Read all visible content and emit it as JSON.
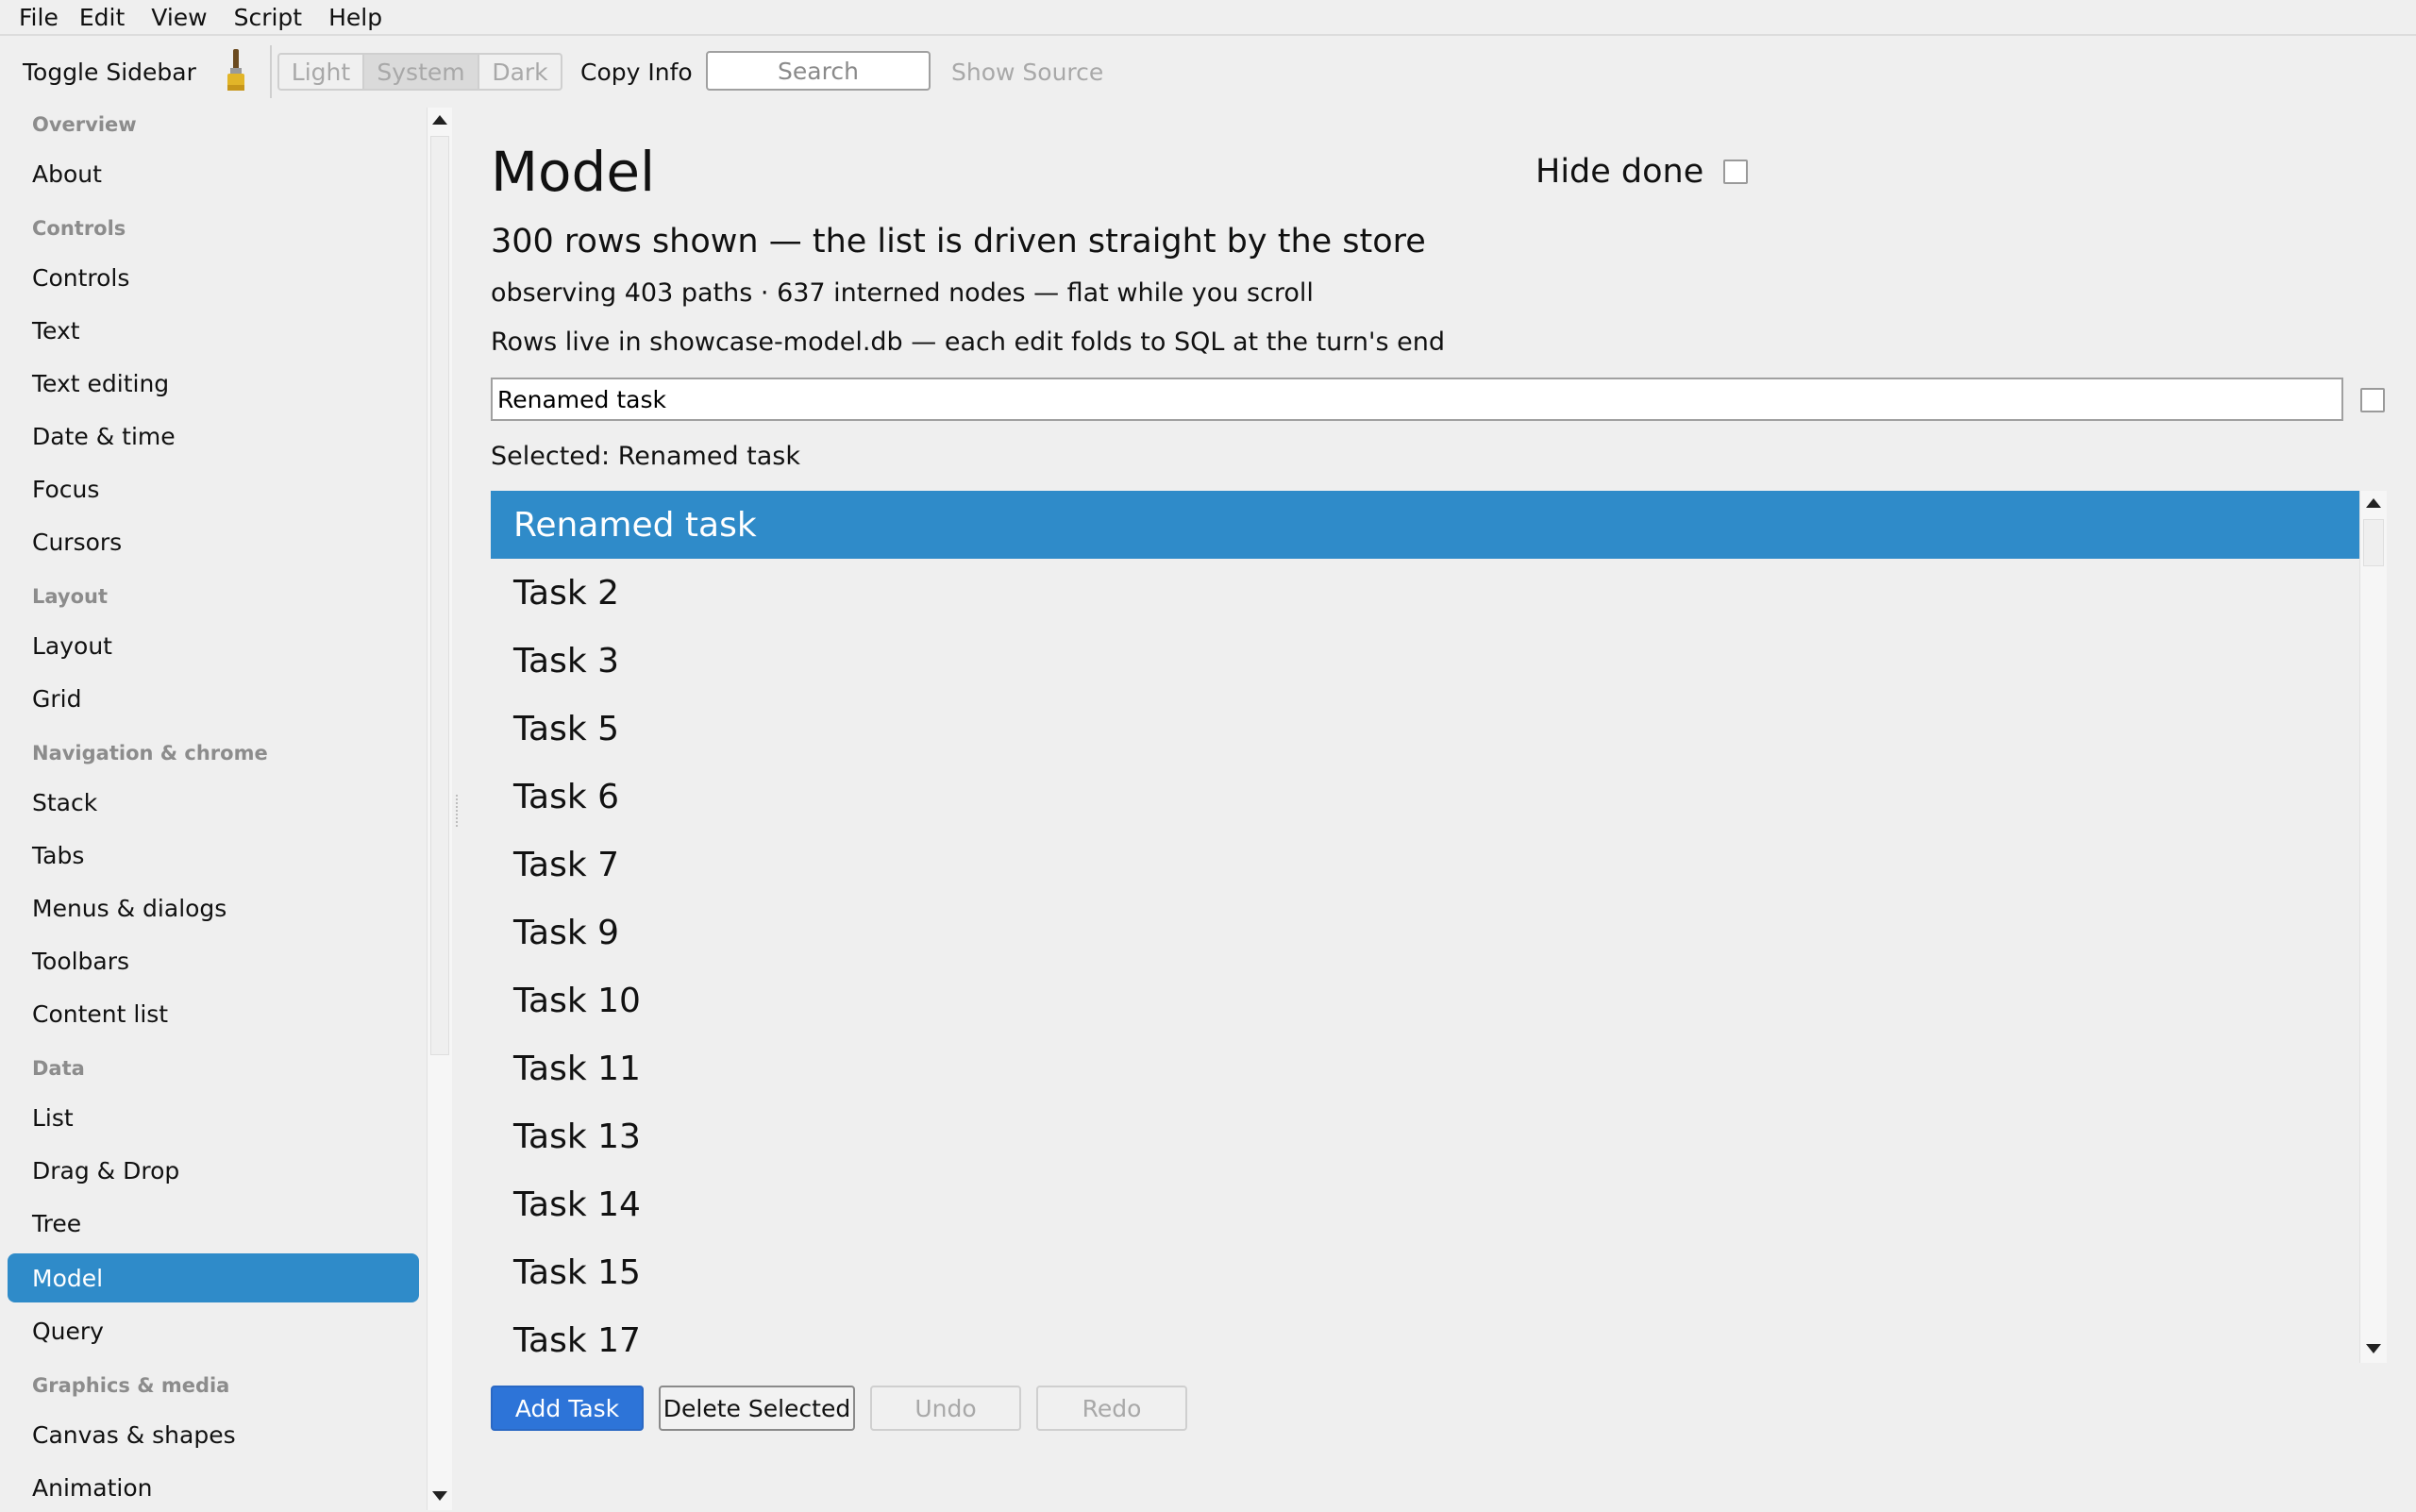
{
  "menubar": [
    "File",
    "Edit",
    "View",
    "Script",
    "Help"
  ],
  "toolbar": {
    "toggle_sidebar": "Toggle Sidebar",
    "theme": {
      "light": "Light",
      "system": "System",
      "dark": "Dark",
      "selected": "System"
    },
    "copy_info": "Copy Info",
    "search_placeholder": "Search",
    "show_source": "Show Source"
  },
  "sidebar": {
    "sections": [
      {
        "label": "Overview",
        "items": [
          "About"
        ]
      },
      {
        "label": "Controls",
        "items": [
          "Controls",
          "Text",
          "Text editing",
          "Date & time",
          "Focus",
          "Cursors"
        ]
      },
      {
        "label": "Layout",
        "items": [
          "Layout",
          "Grid"
        ]
      },
      {
        "label": "Navigation & chrome",
        "items": [
          "Stack",
          "Tabs",
          "Menus & dialogs",
          "Toolbars",
          "Content list"
        ]
      },
      {
        "label": "Data",
        "items": [
          "List",
          "Drag & Drop",
          "Tree",
          "Model",
          "Query"
        ]
      },
      {
        "label": "Graphics & media",
        "items": [
          "Canvas & shapes",
          "Animation"
        ]
      }
    ],
    "selected": "Model"
  },
  "main": {
    "title": "Model",
    "hide_done_label": "Hide done",
    "hide_done_checked": false,
    "rows_shown": "300 rows shown — the list is driven straight by the store",
    "observing": "observing 403 paths · 637 interned nodes — flat while you scroll",
    "rows_live": "Rows live in showcase-model.db — each edit folds to SQL at the turn's end",
    "edit_value": "Renamed task",
    "edit_done_checked": false,
    "selected_label": "Selected: Renamed task",
    "tasks": [
      "Renamed task",
      "Task 2",
      "Task 3",
      "Task 5",
      "Task 6",
      "Task 7",
      "Task 9",
      "Task 10",
      "Task 11",
      "Task 13",
      "Task 14",
      "Task 15",
      "Task 17"
    ],
    "selected_task_index": 0,
    "buttons": {
      "add": "Add Task",
      "delete": "Delete Selected",
      "undo": "Undo",
      "redo": "Redo"
    }
  },
  "colors": {
    "accent": "#2f8bc9",
    "primary_button": "#2d74d8",
    "background": "#efefef"
  }
}
